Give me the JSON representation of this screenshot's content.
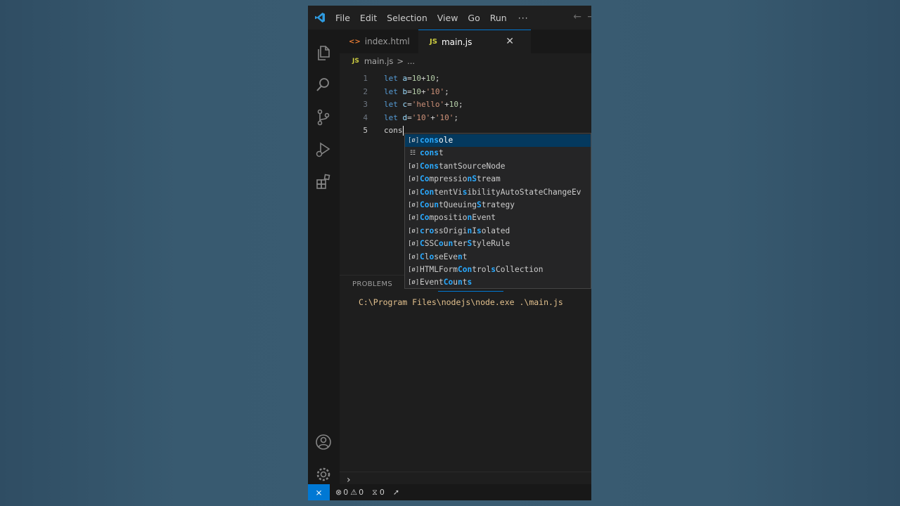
{
  "menu": {
    "items": [
      "File",
      "Edit",
      "Selection",
      "View",
      "Go",
      "Run"
    ],
    "more": "···"
  },
  "tabs": [
    {
      "label": "index.html",
      "icon": "html-file-icon"
    },
    {
      "label": "main.js",
      "icon": "js-file-icon",
      "active": true
    }
  ],
  "breadcrumb": {
    "file": "main.js",
    "sep": ">",
    "rest": "..."
  },
  "editor": {
    "lines": [
      {
        "n": "1",
        "tokens": [
          [
            "kw",
            "let"
          ],
          [
            "op",
            " "
          ],
          [
            "var",
            "a"
          ],
          [
            "op",
            "="
          ],
          [
            "num",
            "10"
          ],
          [
            "op",
            "+"
          ],
          [
            "num",
            "10"
          ],
          [
            "op",
            ";"
          ]
        ]
      },
      {
        "n": "2",
        "tokens": [
          [
            "kw",
            "let"
          ],
          [
            "op",
            " "
          ],
          [
            "var",
            "b"
          ],
          [
            "op",
            "="
          ],
          [
            "num",
            "10"
          ],
          [
            "op",
            "+"
          ],
          [
            "str",
            "'10'"
          ],
          [
            "op",
            ";"
          ]
        ]
      },
      {
        "n": "3",
        "tokens": [
          [
            "kw",
            "let"
          ],
          [
            "op",
            " "
          ],
          [
            "var",
            "c"
          ],
          [
            "op",
            "="
          ],
          [
            "str",
            "'hello'"
          ],
          [
            "op",
            "+"
          ],
          [
            "num",
            "10"
          ],
          [
            "op",
            ";"
          ]
        ]
      },
      {
        "n": "4",
        "tokens": [
          [
            "kw",
            "let"
          ],
          [
            "op",
            " "
          ],
          [
            "var",
            "d"
          ],
          [
            "op",
            "="
          ],
          [
            "str",
            "'10'"
          ],
          [
            "op",
            "+"
          ],
          [
            "str",
            "'10'"
          ],
          [
            "op",
            ";"
          ]
        ]
      },
      {
        "n": "5",
        "tokens": [
          [
            "op",
            "cons"
          ]
        ],
        "active": true
      }
    ]
  },
  "suggestions": [
    {
      "label": "console",
      "kind": "variable",
      "selected": true
    },
    {
      "label": "const",
      "kind": "snippet"
    },
    {
      "label": "ConstantSourceNode",
      "kind": "variable"
    },
    {
      "label": "CompressionStream",
      "kind": "variable"
    },
    {
      "label": "ContentVisibilityAutoStateChangeEv",
      "kind": "variable"
    },
    {
      "label": "CountQueuingStrategy",
      "kind": "variable"
    },
    {
      "label": "CompositionEvent",
      "kind": "variable"
    },
    {
      "label": "crossOriginIsolated",
      "kind": "variable"
    },
    {
      "label": "CSSCounterStyleRule",
      "kind": "variable"
    },
    {
      "label": "CloseEvent",
      "kind": "variable"
    },
    {
      "label": "HTMLFormControlsCollection",
      "kind": "variable"
    },
    {
      "label": "EventCounts",
      "kind": "variable"
    }
  ],
  "panel": {
    "tab": "PROBLEMS",
    "terminal_line": "C:\\Program Files\\nodejs\\node.exe .\\main.js"
  },
  "status": {
    "errors": "0",
    "warnings": "0",
    "ports": "0"
  },
  "colors": {
    "accent": "#0078d4",
    "keyword": "#569cd6",
    "variable": "#9cdcfe",
    "number": "#b5cea8",
    "string": "#ce9178",
    "highlight": "#2aaaff",
    "selection": "#04395e"
  }
}
